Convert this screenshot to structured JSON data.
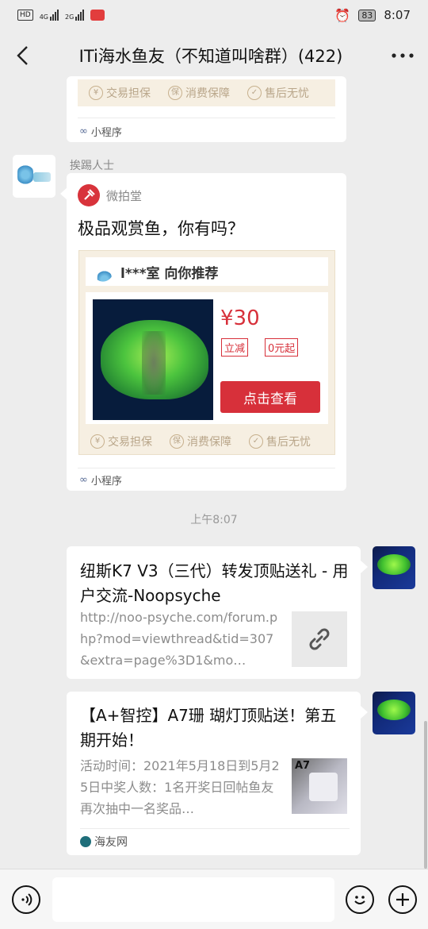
{
  "status_bar": {
    "left_icons": [
      "HD",
      "4G",
      "2G"
    ],
    "battery": "83",
    "time": "8:07"
  },
  "header": {
    "back_icon": "chevron-left-icon",
    "title": "ITi海水鱼友（不知道叫啥群）(422)",
    "more_icon": "more-dots-icon"
  },
  "top_card": {
    "guarantees": [
      "交易担保",
      "消费保障",
      "售后无忧"
    ],
    "mini_program_label": "小程序"
  },
  "message_1": {
    "sender": "挨踢人士",
    "app_name": "微拍堂",
    "headline": "极品观赏鱼，你有吗？",
    "shop_line": "l***室 向你推荐",
    "price": "¥30",
    "tags": [
      "立减",
      "0元起"
    ],
    "cta": "点击查看",
    "guarantees": [
      "交易担保",
      "消费保障",
      "售后无忧"
    ],
    "mini_program_label": "小程序"
  },
  "timestamp": "上午8:07",
  "message_2": {
    "title": "纽斯K7 V3（三代）转发顶贴送礼 - 用户交流-Noopsyche",
    "description": "http://noo-psyche.com/forum.php?mod=viewthread&tid=307&extra=page%3D1&mo…",
    "thumb_icon": "link-icon"
  },
  "message_3": {
    "title": "【A+智控】A7珊 瑚灯顶贴送！第五期开始！",
    "description": "活动时间：2021年5月18日到5月25日中奖人数：1名开奖日回帖鱼友再次抽中一名奖品…",
    "thumb_label": "A7",
    "source": "海友网"
  },
  "input_bar": {
    "voice_icon": "voice-icon",
    "emoji_icon": "emoji-icon",
    "add_icon": "plus-icon"
  },
  "colors": {
    "background": "#ededed",
    "cta_red": "#d7303a",
    "price_red": "#d7303a",
    "weipaitang_red": "#d8333b"
  }
}
